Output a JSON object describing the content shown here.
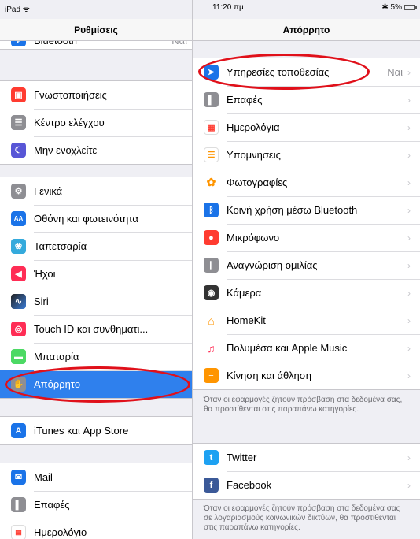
{
  "status": {
    "left": "iPad ᯤ",
    "time": "11:20 πμ",
    "battery": "✱ 5%"
  },
  "left": {
    "title": "Ρυθμίσεις",
    "top_partial": {
      "label": "Bluetooth",
      "value": "Ναι",
      "color": "#1a73e8"
    },
    "group1": [
      {
        "label": "Γνωστοποιήσεις",
        "color": "#ff3b30",
        "icon": "notifications-icon"
      },
      {
        "label": "Κέντρο ελέγχου",
        "color": "#8e8e93",
        "icon": "control-center-icon"
      },
      {
        "label": "Μην ενοχλείτε",
        "color": "#5856d6",
        "icon": "moon-icon"
      }
    ],
    "group2": [
      {
        "label": "Γενικά",
        "color": "#8e8e93",
        "icon": "gear-icon"
      },
      {
        "label": "Οθόνη και φωτεινότητα",
        "color": "#1a73e8",
        "icon": "display-icon"
      },
      {
        "label": "Ταπετσαρία",
        "color": "#34aadc",
        "icon": "wallpaper-icon"
      },
      {
        "label": "Ήχοι",
        "color": "#ff2d55",
        "icon": "sounds-icon"
      },
      {
        "label": "Siri",
        "color": "#333333",
        "icon": "siri-icon"
      },
      {
        "label": "Touch ID και συνθηματι...",
        "color": "#ff2d55",
        "icon": "fingerprint-icon"
      },
      {
        "label": "Μπαταρία",
        "color": "#4cd964",
        "icon": "battery-icon"
      },
      {
        "label": "Απόρρητο",
        "color": "#8e8e93",
        "icon": "hand-icon"
      }
    ],
    "group3": [
      {
        "label": "iTunes και App Store",
        "color": "#1a73e8",
        "icon": "app-store-icon"
      }
    ],
    "group4": [
      {
        "label": "Mail",
        "color": "#1a73e8",
        "icon": "mail-icon"
      },
      {
        "label": "Επαφές",
        "color": "#8e8e93",
        "icon": "contacts-icon"
      },
      {
        "label": "Ημερολόγιο",
        "color": "#ff3b30",
        "icon": "calendar-icon"
      }
    ]
  },
  "right": {
    "title": "Απόρρητο",
    "group1": [
      {
        "label": "Υπηρεσίες τοποθεσίας",
        "value": "Ναι",
        "color": "#1a73e8",
        "icon": "location-arrow-icon"
      },
      {
        "label": "Επαφές",
        "color": "#8e8e93",
        "icon": "contacts-icon"
      },
      {
        "label": "Ημερολόγια",
        "color": "#ff3b30",
        "icon": "calendar-icon"
      },
      {
        "label": "Υπομνήσεις",
        "color": "#ffffff",
        "icon": "reminders-icon"
      },
      {
        "label": "Φωτογραφίες",
        "color": "#ffffff",
        "icon": "photos-icon"
      },
      {
        "label": "Κοινή χρήση μέσω Bluetooth",
        "color": "#1a73e8",
        "icon": "bluetooth-icon"
      },
      {
        "label": "Μικρόφωνο",
        "color": "#ff3b30",
        "icon": "microphone-icon"
      },
      {
        "label": "Αναγνώριση ομιλίας",
        "color": "#8e8e93",
        "icon": "speech-waveform-icon"
      },
      {
        "label": "Κάμερα",
        "color": "#333333",
        "icon": "camera-icon"
      },
      {
        "label": "HomeKit",
        "color": "#ffffff",
        "icon": "home-icon"
      },
      {
        "label": "Πολυμέσα και Apple Music",
        "color": "#ffffff",
        "icon": "music-note-icon"
      },
      {
        "label": "Κίνηση και άθληση",
        "color": "#ff9500",
        "icon": "motion-icon"
      }
    ],
    "note1": "Όταν οι εφαρμογές ζητούν πρόσβαση στα δεδομένα σας, θα προστίθενται στις παραπάνω κατηγορίες.",
    "group2": [
      {
        "label": "Twitter",
        "color": "#1da1f2",
        "icon": "twitter-icon"
      },
      {
        "label": "Facebook",
        "color": "#3b5998",
        "icon": "facebook-icon"
      }
    ],
    "note2": "Όταν οι εφαρμογές ζητούν πρόσβαση στα δεδομένα σας σε λογαριασμούς κοινωνικών δικτύων, θα προστίθενται στις παραπάνω κατηγορίες."
  },
  "chevron": "›"
}
